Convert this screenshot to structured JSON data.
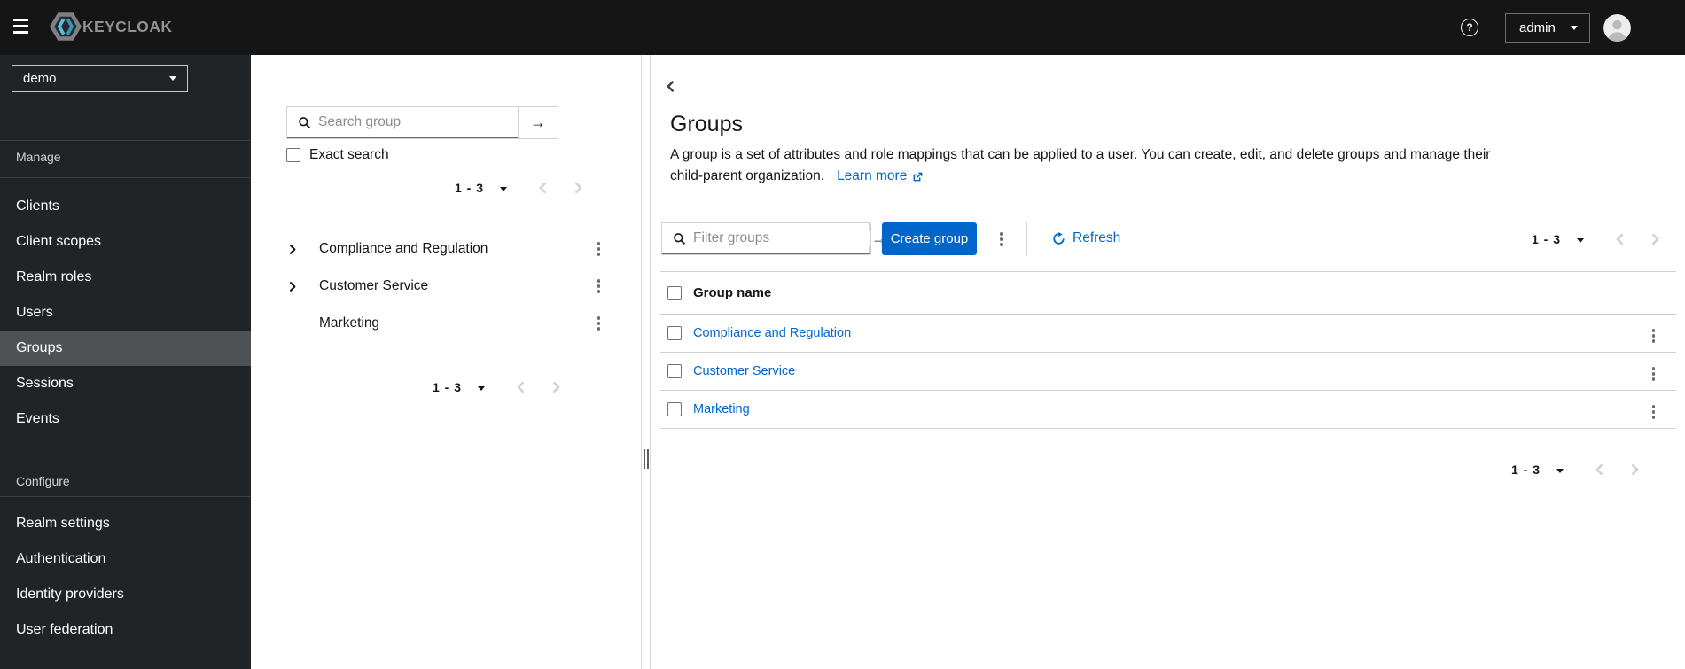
{
  "topbar": {
    "brand": "KEYCLOAK",
    "username": "admin"
  },
  "sidebar": {
    "realm_selector": "demo",
    "selected_item": "Groups",
    "sections": [
      {
        "label": "Manage",
        "items": [
          "Clients",
          "Client scopes",
          "Realm roles",
          "Users",
          "Groups",
          "Sessions",
          "Events"
        ]
      },
      {
        "label": "Configure",
        "items": [
          "Realm settings",
          "Authentication",
          "Identity providers",
          "User federation"
        ]
      }
    ]
  },
  "tree_panel": {
    "search": {
      "placeholder": "Search group"
    },
    "exact_search_label": "Exact search",
    "pagination_top": "1 - 3",
    "pagination_bottom": "1 - 3",
    "items": [
      {
        "label": "Compliance and Regulation",
        "expandable": true
      },
      {
        "label": "Customer Service",
        "expandable": true
      },
      {
        "label": "Marketing",
        "expandable": false
      }
    ]
  },
  "main": {
    "title": "Groups",
    "description_line1": "A group is a set of attributes and role mappings that can be applied to a user. You can create, edit, and delete groups and manage their",
    "description_line2": "child-parent organization.",
    "learn_more_label": "Learn more",
    "toolbar": {
      "filter": {
        "placeholder": "Filter groups"
      },
      "create_button_label": "Create group",
      "refresh_label": "Refresh",
      "pagination": "1 - 3"
    },
    "table": {
      "header": "Group name",
      "rows": [
        "Compliance and Regulation",
        "Customer Service",
        "Marketing"
      ]
    },
    "pagination_bottom": "1 - 3"
  },
  "icons": {
    "help": "?",
    "arrow_right": "→"
  },
  "colors": {
    "accent_blue": "#0066cc",
    "topbar_bg": "#151515",
    "sidebar_bg": "#212427",
    "selected_nav_bg": "#4f5255",
    "border_light": "#d2d2d2"
  }
}
